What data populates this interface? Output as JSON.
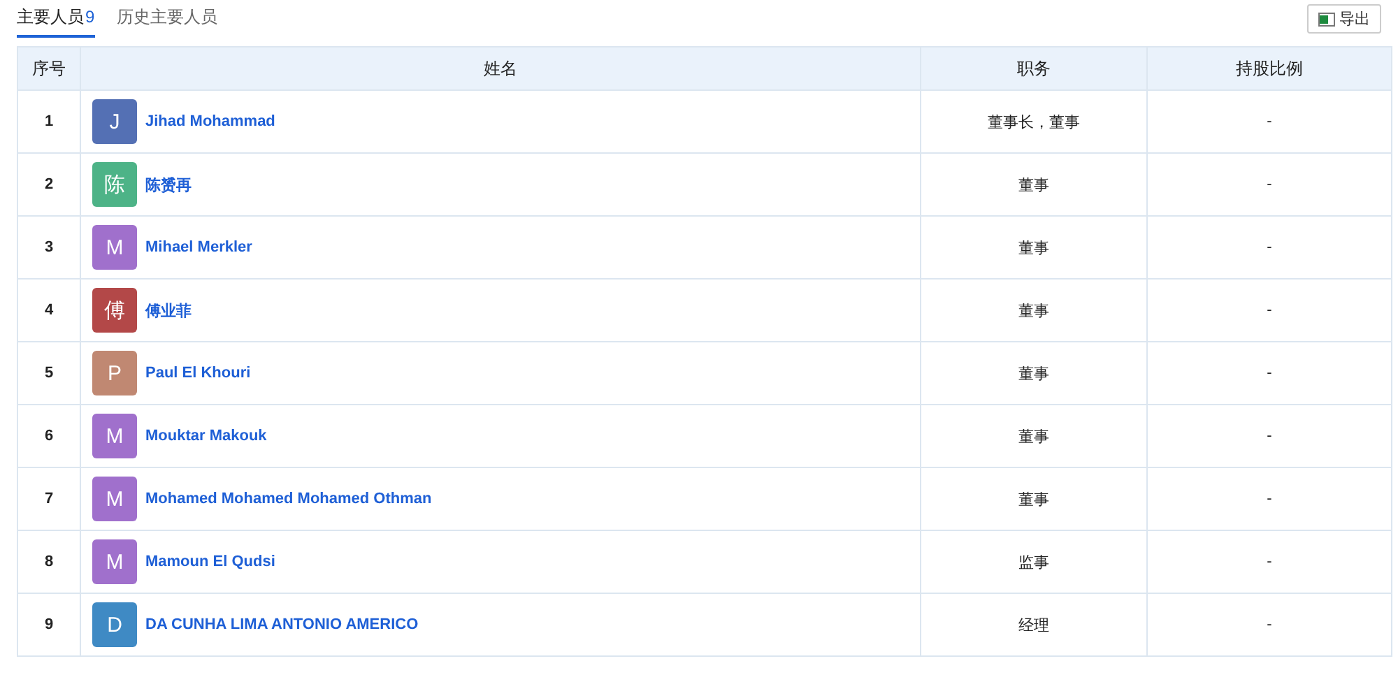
{
  "tabs": [
    {
      "label": "主要人员",
      "count": "9",
      "selected": true
    },
    {
      "label": "历史主要人员",
      "selected": false
    }
  ],
  "export_button": {
    "label": "导出"
  },
  "table": {
    "columns": [
      "序号",
      "姓名",
      "职务",
      "持股比例"
    ],
    "rows": [
      {
        "index": "1",
        "avatar": "J",
        "color": "#5470b4",
        "name": "Jihad Mohammad",
        "role": "董事长，董事",
        "share": "-"
      },
      {
        "index": "2",
        "avatar": "陈",
        "color": "#4db387",
        "name": "陈赟再",
        "role": "董事",
        "share": "-"
      },
      {
        "index": "3",
        "avatar": "M",
        "color": "#a070cc",
        "name": "Mihael Merkler",
        "role": "董事",
        "share": "-"
      },
      {
        "index": "4",
        "avatar": "傅",
        "color": "#b34848",
        "name": "傅业菲",
        "role": "董事",
        "share": "-"
      },
      {
        "index": "5",
        "avatar": "P",
        "color": "#c08872",
        "name": "Paul El Khouri",
        "role": "董事",
        "share": "-"
      },
      {
        "index": "6",
        "avatar": "M",
        "color": "#a070cc",
        "name": "Mouktar Makouk",
        "role": "董事",
        "share": "-"
      },
      {
        "index": "7",
        "avatar": "M",
        "color": "#a070cc",
        "name": "Mohamed Mohamed Mohamed Othman",
        "role": "董事",
        "share": "-"
      },
      {
        "index": "8",
        "avatar": "M",
        "color": "#a070cc",
        "name": "Mamoun El Qudsi",
        "role": "监事",
        "share": "-"
      },
      {
        "index": "9",
        "avatar": "D",
        "color": "#3f8ac4",
        "name": "DA CUNHA LIMA ANTONIO AMERICO",
        "role": "经理",
        "share": "-"
      }
    ]
  }
}
